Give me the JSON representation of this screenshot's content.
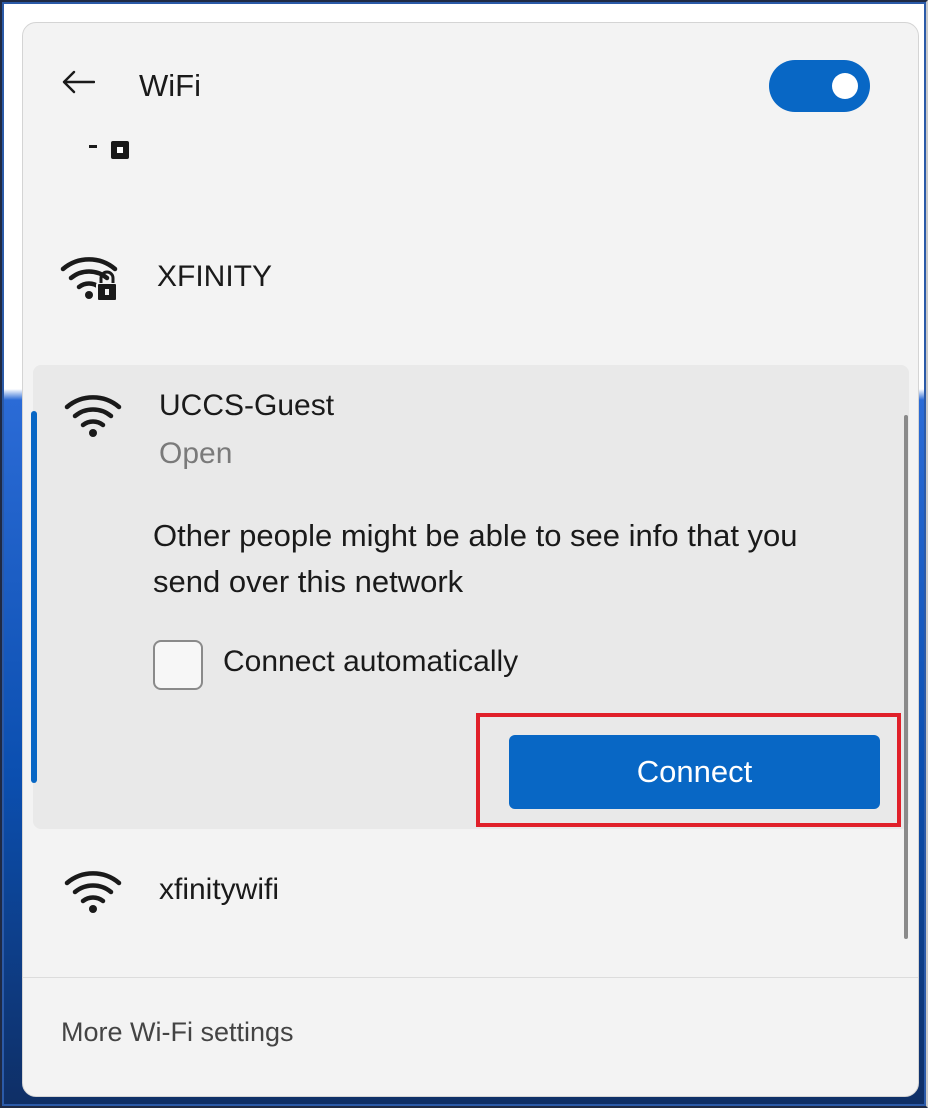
{
  "header": {
    "title": "WiFi",
    "back_icon": "arrow-left-icon",
    "toggle_state": "on"
  },
  "networks": [
    {
      "name": "XFINITY",
      "icon": "wifi-secured-icon"
    },
    {
      "name": "UCCS-Guest",
      "icon": "wifi-icon",
      "status": "Open",
      "warning": "Other people might be able to see info that you send over this network",
      "auto_connect_label": "Connect automatically",
      "auto_connect_checked": false,
      "connect_label": "Connect"
    },
    {
      "name": "xfinitywifi",
      "icon": "wifi-icon"
    }
  ],
  "footer": {
    "settings_link": "More Wi-Fi settings"
  },
  "colors": {
    "accent": "#0867c5",
    "highlight": "#e0202a",
    "panel_bg": "#f3f3f3",
    "expanded_bg": "#e9e9e9"
  }
}
